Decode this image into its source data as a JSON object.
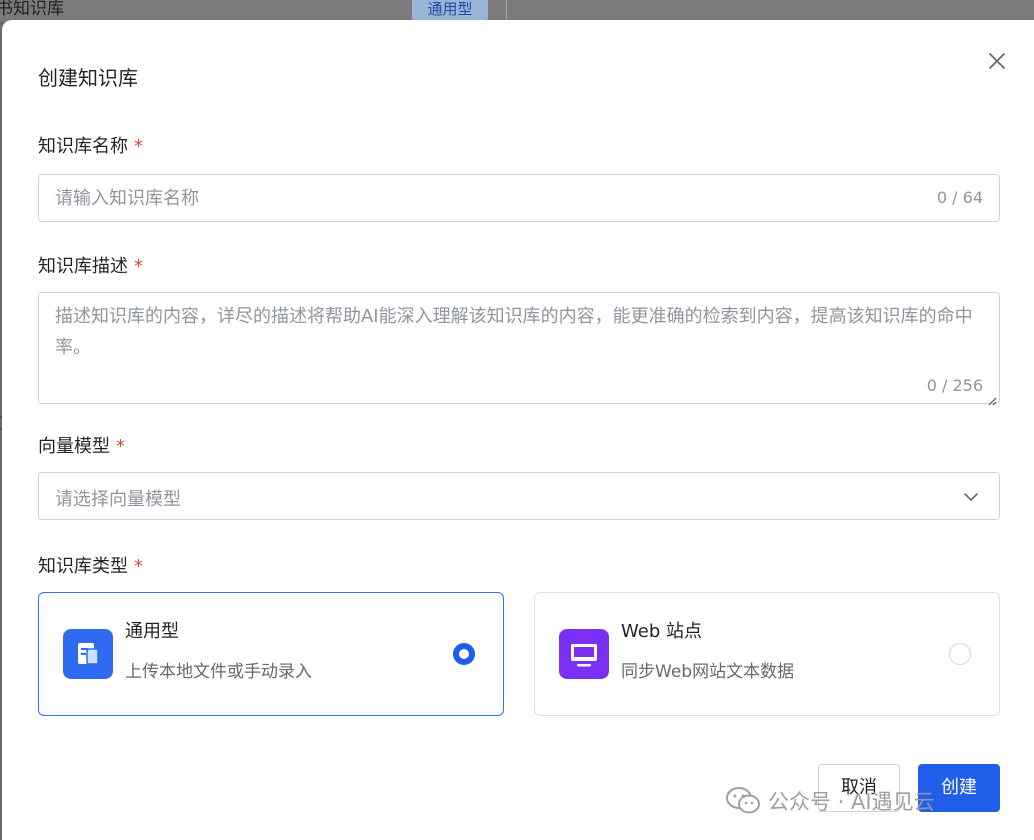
{
  "background": {
    "title": "书知识库",
    "tag": "通用型"
  },
  "modal": {
    "title": "创建知识库",
    "close_icon": "close-icon"
  },
  "fields": {
    "name": {
      "label": "知识库名称",
      "required_mark": "*",
      "placeholder": "请输入知识库名称",
      "value": "",
      "counter": "0 / 64"
    },
    "description": {
      "label": "知识库描述",
      "required_mark": "*",
      "placeholder": "描述知识库的内容，详尽的描述将帮助AI能深入理解该知识库的内容，能更准确的检索到内容，提高该知识库的命中率。",
      "value": "",
      "counter": "0 / 256"
    },
    "vector_model": {
      "label": "向量模型",
      "required_mark": "*",
      "placeholder": "请选择向量模型",
      "icon": "chevron-down-icon"
    },
    "kb_type": {
      "label": "知识库类型",
      "required_mark": "*",
      "options": [
        {
          "title": "通用型",
          "desc": "上传本地文件或手动录入",
          "icon": "document-icon",
          "icon_color": "#2f6bf2",
          "selected": true
        },
        {
          "title": "Web 站点",
          "desc": "同步Web网站文本数据",
          "icon": "monitor-icon",
          "icon_color": "#7b2ff2",
          "selected": false
        }
      ]
    }
  },
  "buttons": {
    "cancel": "取消",
    "create": "创建"
  },
  "watermark": {
    "text": "公众号 · AI遇见云",
    "icon": "wechat-icon"
  },
  "colors": {
    "primary": "#1f5ee8",
    "required": "#e5443b",
    "selected_border": "#3370ff"
  }
}
